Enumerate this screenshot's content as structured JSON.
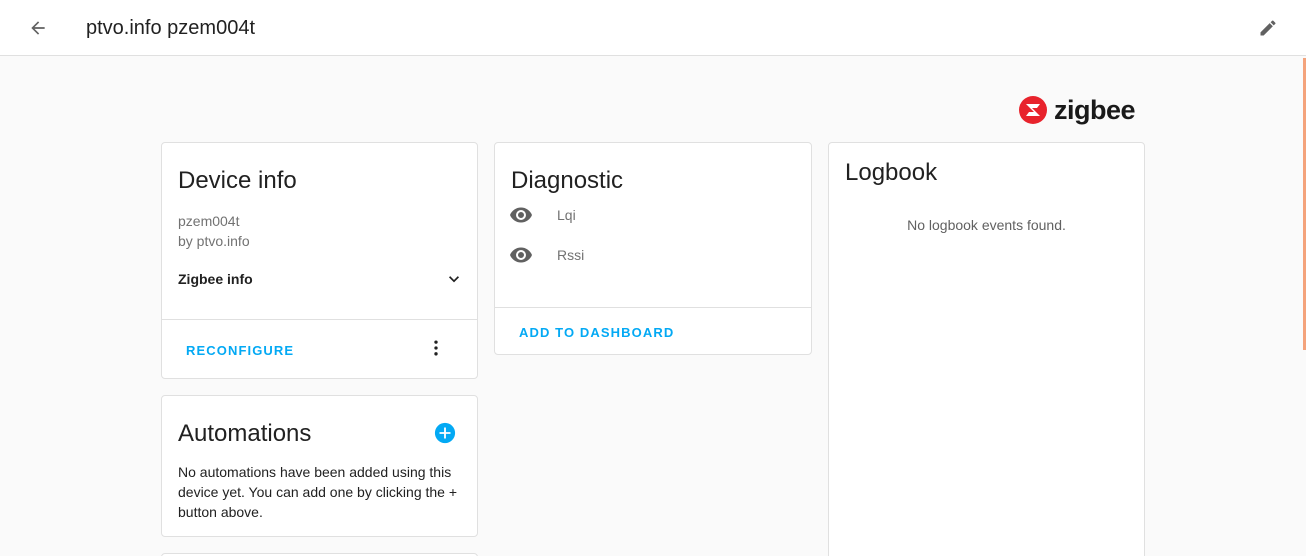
{
  "header": {
    "title": "ptvo.info pzem004t"
  },
  "brand": {
    "logo_text": "zigbee",
    "logo_color": "#e8232c"
  },
  "device_info": {
    "title": "Device info",
    "model": "pzem004t",
    "manufacturer": "by ptvo.info",
    "expander_label": "Zigbee info",
    "reconfigure_label": "RECONFIGURE"
  },
  "automations": {
    "title": "Automations",
    "empty_text": "No automations have been added using this device yet. You can add one by clicking the + button above."
  },
  "diagnostic": {
    "title": "Diagnostic",
    "entities": [
      {
        "label": "Lqi",
        "icon": "eye-icon"
      },
      {
        "label": "Rssi",
        "icon": "eye-icon"
      }
    ],
    "add_label": "ADD TO DASHBOARD"
  },
  "logbook": {
    "title": "Logbook",
    "empty_text": "No logbook events found."
  },
  "colors": {
    "accent": "#03a9f4",
    "secondary_text": "#727272"
  }
}
